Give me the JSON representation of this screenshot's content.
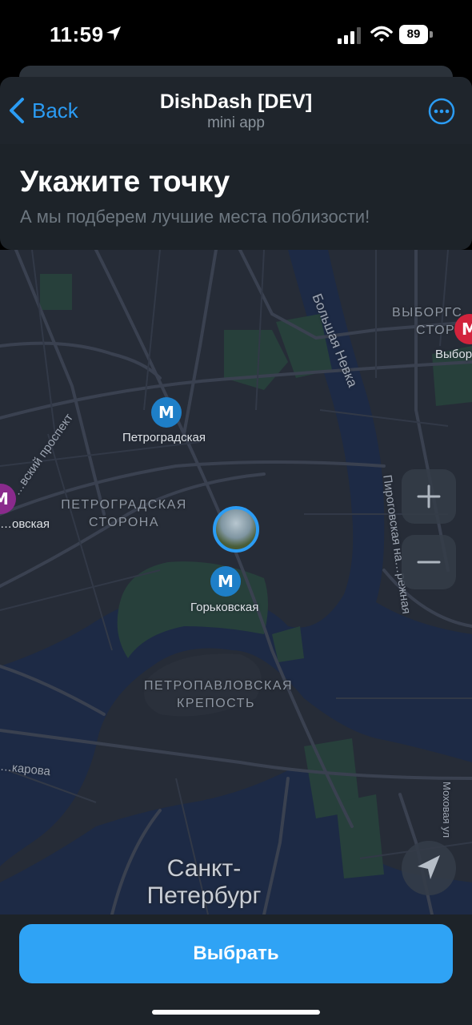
{
  "status_bar": {
    "time": "11:59",
    "battery": "89"
  },
  "nav": {
    "back_label": "Back",
    "title": "DishDash [DEV]",
    "subtitle": "mini app"
  },
  "panel": {
    "heading": "Укажите точку",
    "hint": "А мы подберем лучшие места поблизости!"
  },
  "map": {
    "metro_stations": [
      {
        "name": "Петроградская",
        "color": "#1e7fc8"
      },
      {
        "name": "Горьковская",
        "color": "#1e7fc8"
      },
      {
        "name": "…овская",
        "color": "#8a2a8c"
      },
      {
        "name": "Выбор…",
        "color": "#d2233c"
      }
    ],
    "labels": {
      "petrogradskaya_storona": [
        "ПЕТРОГРАДСКАЯ",
        "СТОРОНА"
      ],
      "petropavlovskaya": [
        "ПЕТРОПАВЛОВСКАЯ",
        "КРЕПОСТЬ"
      ],
      "vyborgskaya_storona": [
        "ВЫБОРГС…",
        "СТОР…"
      ],
      "city": [
        "Санкт-",
        "Петербург"
      ],
      "bolshaya_nevka": "Большая Невка",
      "pirogovskaya": "Пироговская на…режная",
      "prospekt": "…вский проспект",
      "karova": "…карова",
      "mokhovaya": "Моховая ул"
    },
    "controls": {
      "zoom_in": "+",
      "zoom_out": "−"
    },
    "colors": {
      "land": "#262c37",
      "water": "#1d2a45",
      "park": "#27403b",
      "roads": "#3a4150",
      "accent": "#2b9cf4"
    }
  },
  "footer": {
    "select_label": "Выбрать"
  }
}
